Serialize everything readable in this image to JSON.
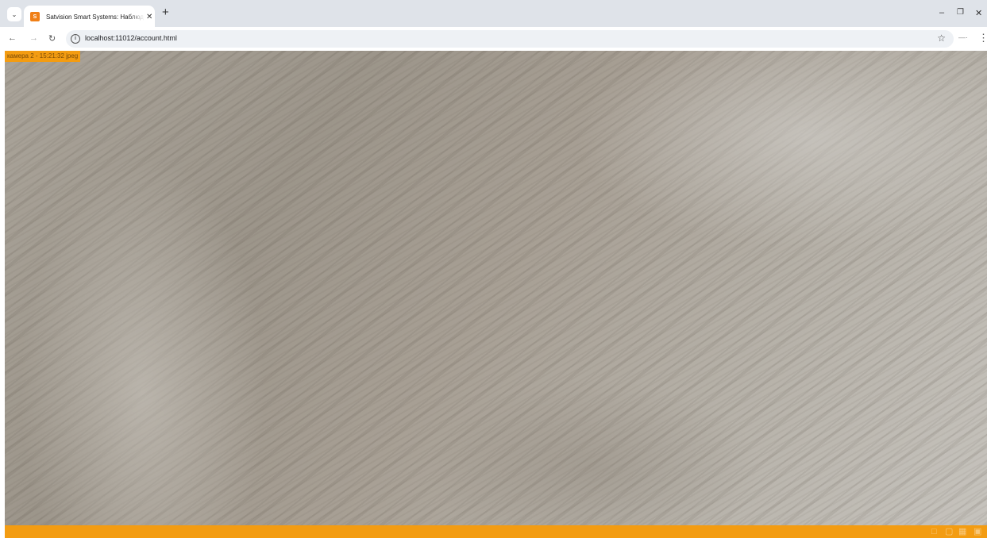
{
  "browser": {
    "tab_title": "Satvision Smart Systems: Наблюдение",
    "favicon_text": "S",
    "url": "localhost:11012/account.html"
  },
  "camera": {
    "label": "камера 2 - 15:21:32 jpeg",
    "accent_color": "#f39c12"
  },
  "icons": {
    "tab_search": "chevron-down-icon",
    "new_tab": "plus-icon",
    "back": "arrow-left-icon",
    "forward": "arrow-right-icon",
    "reload": "reload-icon",
    "site_info": "info-icon",
    "bookmark": "star-icon",
    "extension": "extension-icon",
    "menu": "kebab-menu-icon",
    "camera_controls": [
      "screenshot-icon",
      "record-icon",
      "layout-icon",
      "fullscreen-icon"
    ]
  }
}
